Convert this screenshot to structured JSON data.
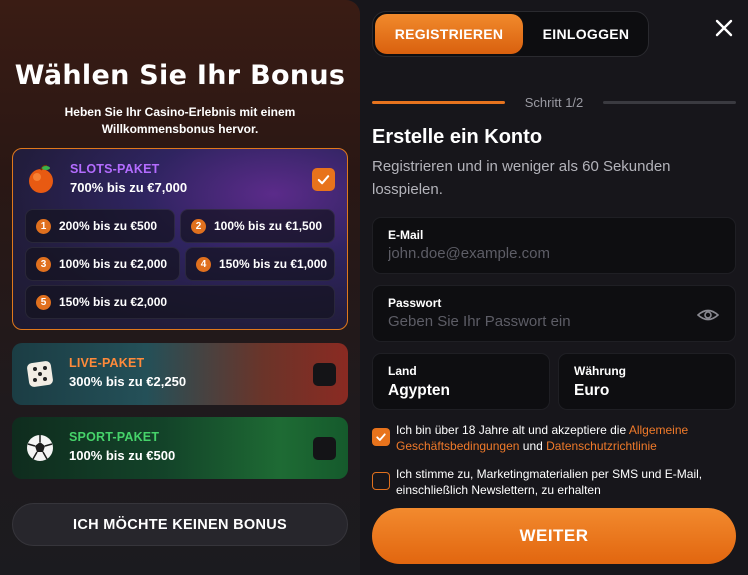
{
  "left": {
    "title": "Wählen Sie Ihr Bonus",
    "subtitle": "Heben Sie Ihr Casino-Erlebnis mit einem Willkommensbonus hervor.",
    "packages": {
      "slots": {
        "name": "SLOTS-PAKET",
        "amount": "700% bis zu €7,000",
        "name_color": "#b46cff",
        "selected": true,
        "options": [
          {
            "num": "1",
            "text": "200% bis zu €500"
          },
          {
            "num": "2",
            "text": "100% bis zu €1,500"
          },
          {
            "num": "3",
            "text": "100% bis zu €2,000"
          },
          {
            "num": "4",
            "text": "150% bis zu €1,000"
          },
          {
            "num": "5",
            "text": "150% bis zu €2,000"
          }
        ]
      },
      "live": {
        "name": "LIVE-PAKET",
        "amount": "300% bis zu €2,250",
        "name_color": "#ff8a3a",
        "selected": false
      },
      "sport": {
        "name": "SPORT-PAKET",
        "amount": "100% bis zu €500",
        "name_color": "#46d36a",
        "selected": false
      }
    },
    "no_bonus_label": "ICH MÖCHTE KEINEN BONUS"
  },
  "right": {
    "tabs": {
      "register": "REGISTRIEREN",
      "login": "EINLOGGEN",
      "active": "register"
    },
    "step": "Schritt 1/2",
    "title": "Erstelle ein Konto",
    "subtitle": "Registrieren und in weniger als 60 Sekunden losspielen.",
    "email": {
      "label": "E-Mail",
      "placeholder": "john.doe@example.com",
      "value": ""
    },
    "password": {
      "label": "Passwort",
      "placeholder": "Geben Sie Ihr Passwort ein",
      "value": ""
    },
    "country": {
      "label": "Land",
      "value": "Agypten"
    },
    "currency": {
      "label": "Währung",
      "value": "Euro"
    },
    "terms": {
      "checked": true,
      "text_before": "Ich bin über 18 Jahre alt und akzeptiere die ",
      "link1": "Allgemeine Geschäftsbedingungen",
      "text_mid": " und ",
      "link2": "Datenschutzrichtlinie"
    },
    "marketing": {
      "checked": false,
      "text": "Ich stimme zu, Marketingmaterialien per SMS und E-Mail, einschließlich Newslettern, zu erhalten"
    },
    "submit_label": "WEITER"
  },
  "colors": {
    "accent": "#e8731c",
    "background": "#17161b",
    "field": "#0e0e11"
  }
}
